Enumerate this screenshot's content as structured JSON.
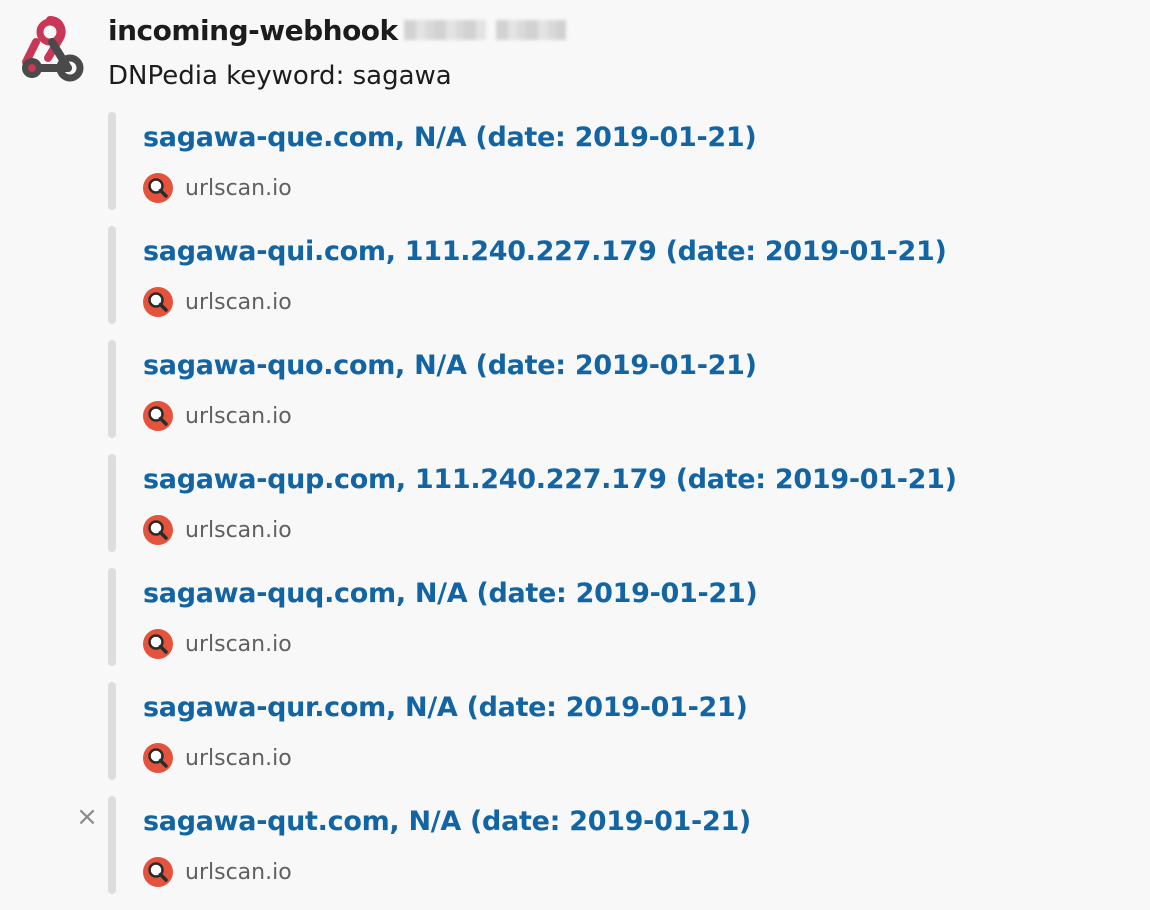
{
  "message": {
    "sender": "incoming-webhook",
    "text": "DNPedia keyword: sagawa",
    "avatar_icon": "webhook-icon"
  },
  "attachments": [
    {
      "title": "sagawa-que.com, N/A (date: 2019-01-21)",
      "footer": "urlscan.io"
    },
    {
      "title": "sagawa-qui.com, 111.240.227.179 (date: 2019-01-21)",
      "footer": "urlscan.io"
    },
    {
      "title": "sagawa-quo.com, N/A (date: 2019-01-21)",
      "footer": "urlscan.io"
    },
    {
      "title": "sagawa-qup.com, 111.240.227.179 (date: 2019-01-21)",
      "footer": "urlscan.io"
    },
    {
      "title": "sagawa-quq.com, N/A (date: 2019-01-21)",
      "footer": "urlscan.io"
    },
    {
      "title": "sagawa-qur.com, N/A (date: 2019-01-21)",
      "footer": "urlscan.io"
    },
    {
      "title": "sagawa-qut.com, N/A (date: 2019-01-21)",
      "footer": "urlscan.io"
    }
  ],
  "icons": {
    "footer_icon": "urlscan-magnifier-icon",
    "remove_attachment": "close-icon"
  },
  "colors": {
    "link": "#1264a3",
    "attachment_bar": "#dddddd",
    "footer_text": "#616061",
    "urlscan_red": "#e5533d",
    "webhook_pink": "#c93756",
    "webhook_dark": "#4a4a4a"
  }
}
